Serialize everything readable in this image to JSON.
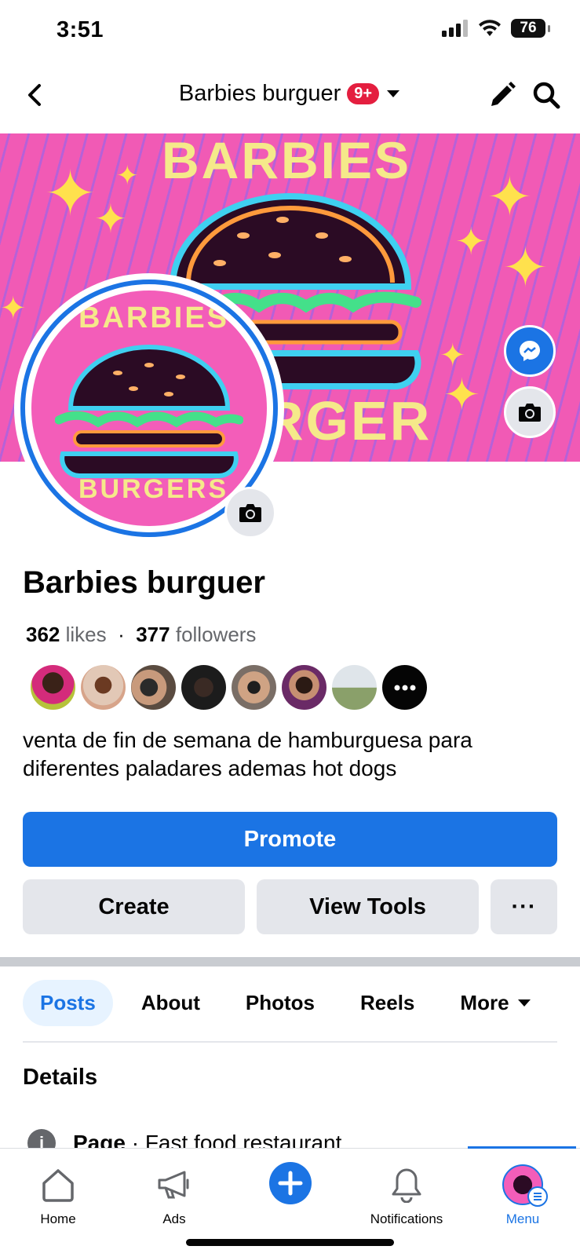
{
  "status_bar": {
    "time": "3:51",
    "battery": "76"
  },
  "header": {
    "title": "Barbies burguer",
    "notification_badge": "9+"
  },
  "cover": {
    "top_text": "BARBIES",
    "bottom_text": "RGER"
  },
  "avatar": {
    "top_text": "BARBIES",
    "bottom_text": "BURGERS"
  },
  "page": {
    "name": "Barbies burguer",
    "likes_count": "362",
    "likes_label": "likes",
    "separator": "·",
    "followers_count": "377",
    "followers_label": "followers",
    "bio": "venta de fin de semana de hamburguesa para diferentes paladares ademas hot dogs"
  },
  "actions": {
    "promote": "Promote",
    "create": "Create",
    "view_tools": "View Tools",
    "more": "···"
  },
  "tabs": [
    {
      "label": "Posts",
      "active": true
    },
    {
      "label": "About"
    },
    {
      "label": "Photos"
    },
    {
      "label": "Reels"
    },
    {
      "label": "More"
    }
  ],
  "details": {
    "title": "Details",
    "page_label": "Page",
    "page_category": " · Fast food restaurant"
  },
  "bottom_nav": [
    {
      "label": "Home",
      "icon": "home-icon"
    },
    {
      "label": "Ads",
      "icon": "megaphone-icon"
    },
    {
      "label": "",
      "icon": "plus-icon"
    },
    {
      "label": "Notifications",
      "icon": "bell-icon"
    },
    {
      "label": "Menu",
      "icon": "menu-avatar-icon",
      "active": true
    }
  ],
  "colors": {
    "accent": "#1b74e4",
    "badge": "#e41e3f",
    "cover_pink": "#f15ab5",
    "cover_text": "#f5e98a"
  }
}
